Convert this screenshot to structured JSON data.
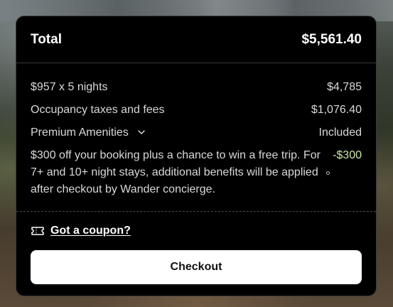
{
  "summary": {
    "total_label": "Total",
    "total_amount": "$5,561.40"
  },
  "line_items": [
    {
      "label": "$957 x 5 nights",
      "value": "$4,785"
    },
    {
      "label": "Occupancy taxes and fees",
      "value": "$1,076.40"
    },
    {
      "label": "Premium Amenities",
      "value": "Included",
      "icon": "chevron-down-icon"
    },
    {
      "label": "$300 off your booking plus a chance to win a free trip. For 7+ and 10+ night stays, additional benefits will be applied after checkout by Wander concierge.",
      "value": "-$300",
      "value_color": "#cde8a8"
    }
  ],
  "coupon": {
    "icon": "ticket-icon",
    "label": "Got a coupon?"
  },
  "checkout": {
    "label": "Checkout"
  }
}
